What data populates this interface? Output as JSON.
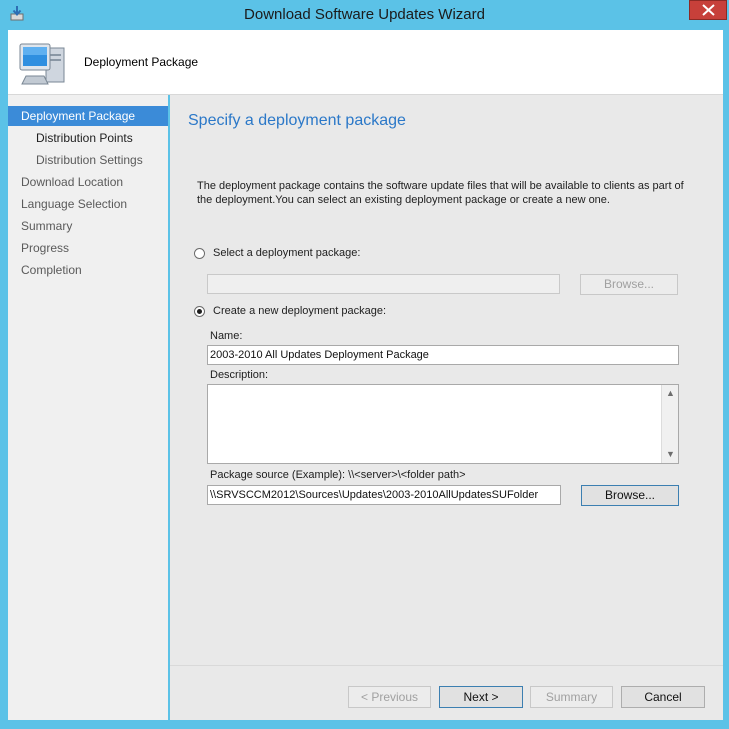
{
  "window": {
    "title": "Download Software Updates Wizard"
  },
  "header": {
    "title": "Deployment Package"
  },
  "nav": {
    "items": [
      {
        "label": "Deployment Package",
        "state": "active"
      },
      {
        "label": "Distribution Points",
        "state": "done"
      },
      {
        "label": "Distribution Settings",
        "state": "pending"
      },
      {
        "label": "Download Location",
        "state": "pending"
      },
      {
        "label": "Language Selection",
        "state": "pending"
      },
      {
        "label": "Summary",
        "state": "pending"
      },
      {
        "label": "Progress",
        "state": "pending"
      },
      {
        "label": "Completion",
        "state": "pending"
      }
    ]
  },
  "main": {
    "heading": "Specify a deployment package",
    "description": "The deployment package contains the software update files that will be available to clients as part of the deployment.You can select an existing deployment package or create a new one.",
    "select_existing": {
      "label": "Select a deployment package:",
      "selected": false,
      "value": "",
      "browse_label": "Browse..."
    },
    "create_new": {
      "label": "Create a new deployment package:",
      "selected": true,
      "name_label": "Name:",
      "name_value": "2003-2010 All Updates Deployment Package",
      "description_label": "Description:",
      "description_value": "",
      "source_label": "Package source (Example): \\\\<server>\\<folder path>",
      "source_value": "\\\\SRVSCCM2012\\Sources\\Updates\\2003-2010AllUpdatesSUFolder",
      "browse_label": "Browse..."
    }
  },
  "footer": {
    "previous": "< Previous",
    "next": "Next >",
    "summary": "Summary",
    "cancel": "Cancel"
  },
  "colors": {
    "frame": "#5bc2e7",
    "nav_active": "#3b8bd8",
    "heading": "#2b78c8",
    "close": "#c7403a"
  },
  "icons": {
    "app": "download-icon",
    "header": "computer-icon",
    "close": "close-icon"
  }
}
